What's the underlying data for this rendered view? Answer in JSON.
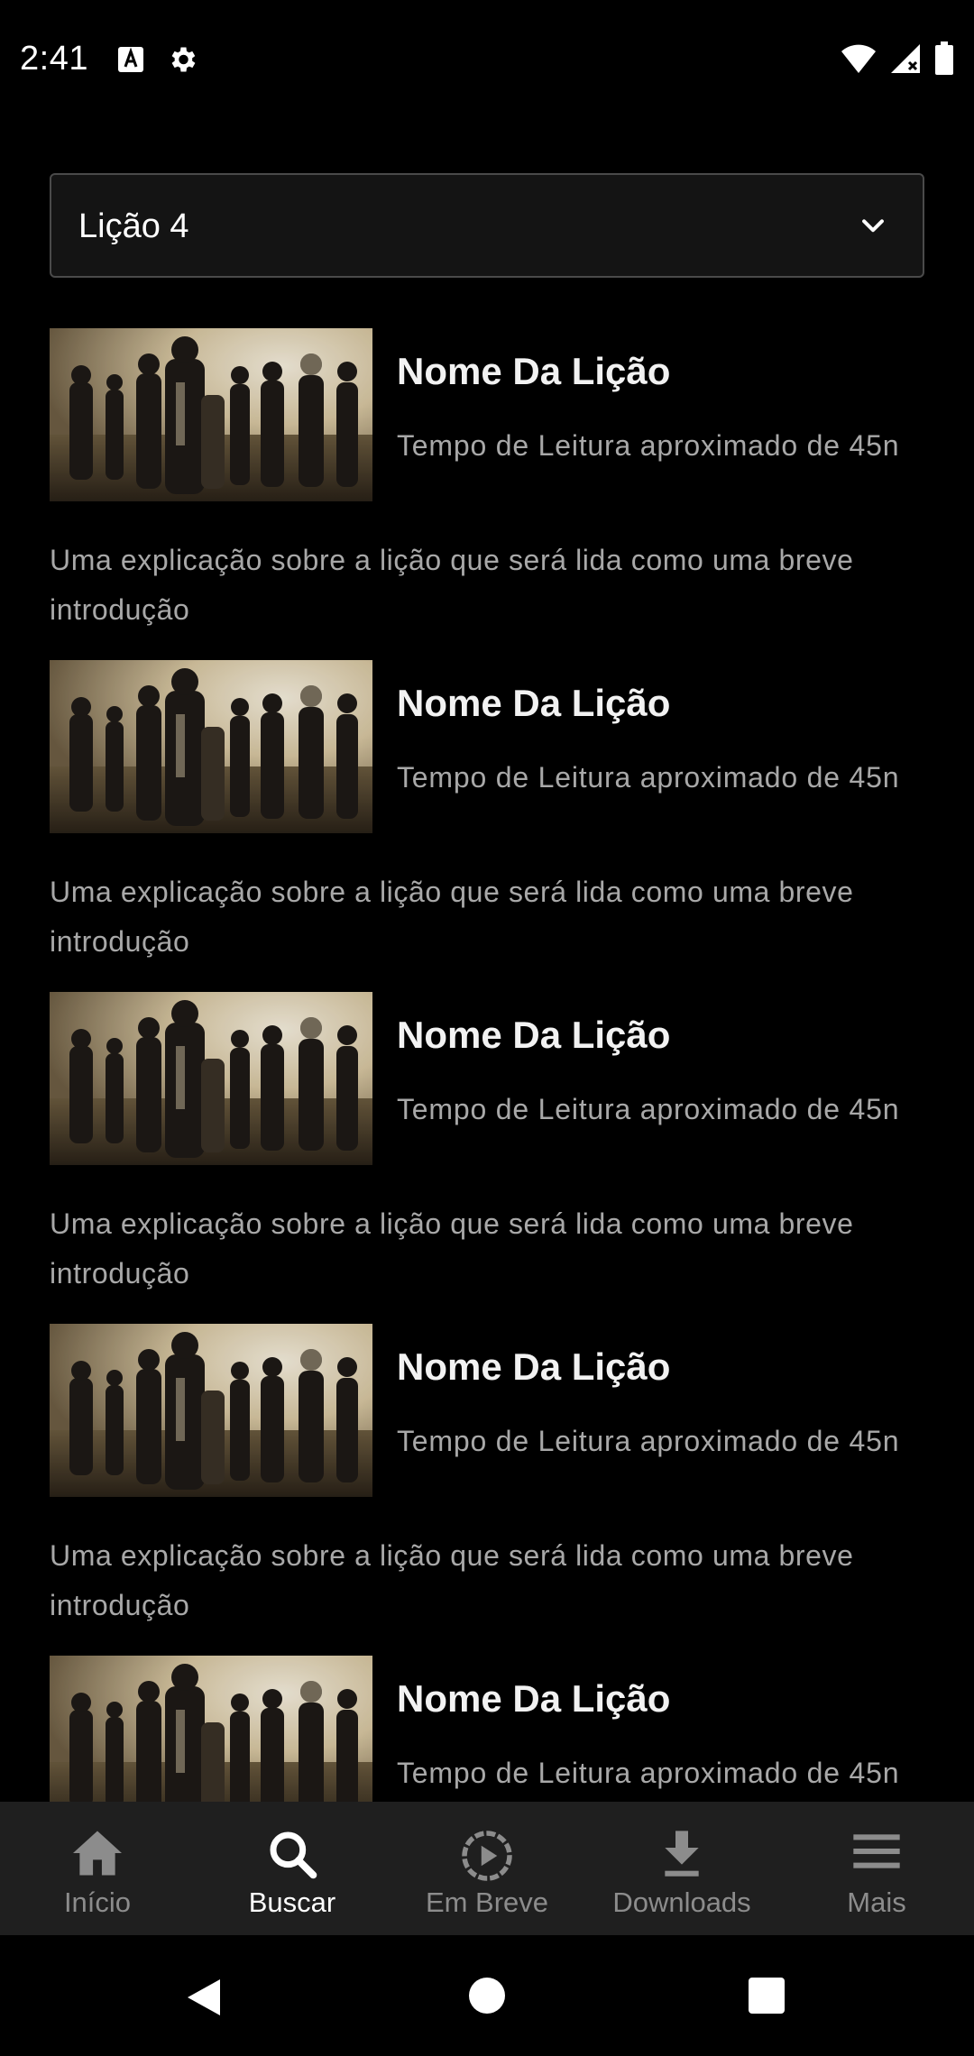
{
  "status_bar": {
    "time": "2:41",
    "left_icons": [
      "text-a-icon",
      "gear-icon"
    ],
    "right_icons": [
      "wifi-icon",
      "signal-icon",
      "battery-icon"
    ]
  },
  "dropdown": {
    "selected": "Lição 4",
    "icon": "chevron-down-icon"
  },
  "lessons": [
    {
      "title": "Nome Da Lição",
      "time": "Tempo de Leitura aproximado de 45n",
      "description": "Uma explicação sobre a lição que será lida como uma breve introdução"
    },
    {
      "title": "Nome Da Lição",
      "time": "Tempo de Leitura aproximado de 45n",
      "description": "Uma explicação sobre a lição que será lida como uma breve introdução"
    },
    {
      "title": "Nome Da Lição",
      "time": "Tempo de Leitura aproximado de 45n",
      "description": "Uma explicação sobre a lição que será lida como uma breve introdução"
    },
    {
      "title": "Nome Da Lição",
      "time": "Tempo de Leitura aproximado de 45n",
      "description": "Uma explicação sobre a lição que será lida como uma breve introdução"
    },
    {
      "title": "Nome Da Lição",
      "time": "Tempo de Leitura aproximado de 45n",
      "description": ""
    }
  ],
  "bottom_nav": {
    "items": [
      {
        "label": "Início",
        "icon": "home-icon",
        "active": false
      },
      {
        "label": "Buscar",
        "icon": "search-icon",
        "active": true
      },
      {
        "label": "Em Breve",
        "icon": "play-circle-icon",
        "active": false
      },
      {
        "label": "Downloads",
        "icon": "download-icon",
        "active": false
      },
      {
        "label": "Mais",
        "icon": "menu-icon",
        "active": false
      }
    ]
  },
  "system_nav": [
    "back-icon",
    "home-circle-icon",
    "recents-icon"
  ],
  "colors": {
    "background": "#000000",
    "nav_background": "#1f1f1f",
    "text_primary": "#ffffff",
    "text_secondary": "#a8a8a8",
    "nav_inactive": "#8c8c8c"
  }
}
